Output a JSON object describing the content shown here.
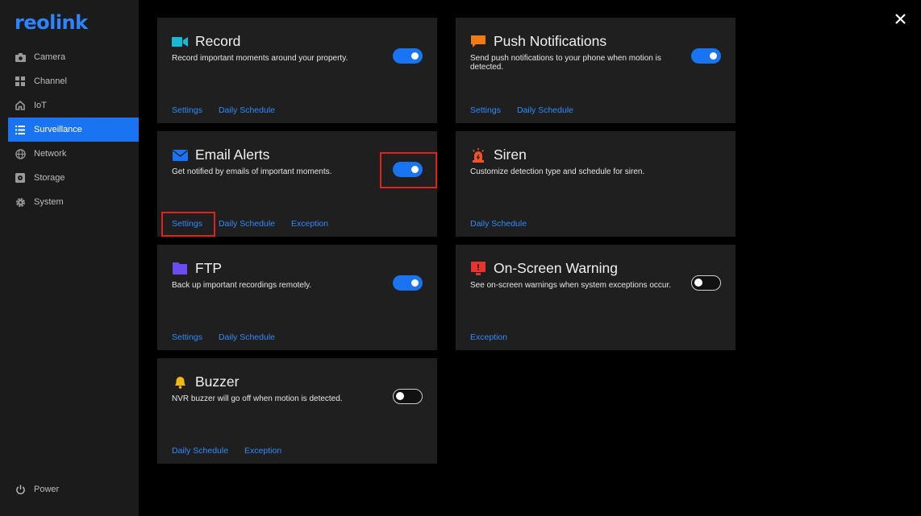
{
  "brand": {
    "logo_text": "reolink"
  },
  "sidebar": {
    "items": [
      {
        "label": "Camera",
        "icon": "camera-icon"
      },
      {
        "label": "Channel",
        "icon": "grid-icon"
      },
      {
        "label": "IoT",
        "icon": "home-icon"
      },
      {
        "label": "Surveillance",
        "icon": "list-icon",
        "active": true
      },
      {
        "label": "Network",
        "icon": "globe-icon"
      },
      {
        "label": "Storage",
        "icon": "storage-icon"
      },
      {
        "label": "System",
        "icon": "gear-icon"
      }
    ],
    "power_label": "Power"
  },
  "cards": {
    "record": {
      "title": "Record",
      "desc": "Record important moments around your property.",
      "enabled": true,
      "links": [
        "Settings",
        "Daily Schedule"
      ],
      "icon": "video-camera-icon",
      "icon_color": "#1bb8d6"
    },
    "push": {
      "title": "Push Notifications",
      "desc": "Send push notifications to your phone when motion is detected.",
      "enabled": true,
      "links": [
        "Settings",
        "Daily Schedule"
      ],
      "icon": "chat-bubble-icon",
      "icon_color": "#f07a16"
    },
    "email": {
      "title": "Email Alerts",
      "desc": "Get notified by emails of important moments.",
      "enabled": true,
      "links": [
        "Settings",
        "Daily Schedule",
        "Exception"
      ],
      "icon": "envelope-icon",
      "icon_color": "#1a73f0"
    },
    "siren": {
      "title": "Siren",
      "desc": "Customize detection type and schedule for siren.",
      "links": [
        "Daily Schedule"
      ],
      "icon": "siren-icon",
      "icon_color": "#f0532a"
    },
    "ftp": {
      "title": "FTP",
      "desc": "Back up important recordings remotely.",
      "enabled": true,
      "links": [
        "Settings",
        "Daily Schedule"
      ],
      "icon": "folder-icon",
      "icon_color": "#6b4cf0"
    },
    "osw": {
      "title": "On-Screen Warning",
      "desc": "See on-screen warnings when system exceptions occur.",
      "enabled": false,
      "links": [
        "Exception"
      ],
      "icon": "monitor-warning-icon",
      "icon_color": "#e8342c"
    },
    "buzzer": {
      "title": "Buzzer",
      "desc": "NVR buzzer will go off when motion is detected.",
      "enabled": false,
      "links": [
        "Daily Schedule",
        "Exception"
      ],
      "icon": "bell-icon",
      "icon_color": "#f2b80f"
    }
  },
  "colors": {
    "accent": "#1a73f0",
    "link": "#2f8bff",
    "highlight": "#e3201b",
    "card_bg": "#1f1f1f",
    "sidebar_bg": "#1b1b1b"
  }
}
